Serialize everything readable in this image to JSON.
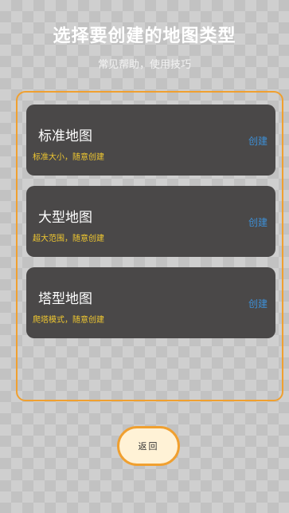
{
  "header": {
    "title": "选择要创建的地图类型",
    "subtitle": "常见帮助，使用技巧"
  },
  "map_types": [
    {
      "title": "标准地图",
      "description": "标准大小，随意创建",
      "action_label": "创建"
    },
    {
      "title": "大型地图",
      "description": "超大范围，随意创建",
      "action_label": "创建"
    },
    {
      "title": "塔型地图",
      "description": "爬塔模式，随意创建",
      "action_label": "创建"
    }
  ],
  "footer": {
    "back_label": "返回"
  },
  "colors": {
    "accent_border": "#f0a030",
    "card_background": "#4a4848",
    "description_text": "#f0c830",
    "action_link": "#3d8fd6"
  }
}
